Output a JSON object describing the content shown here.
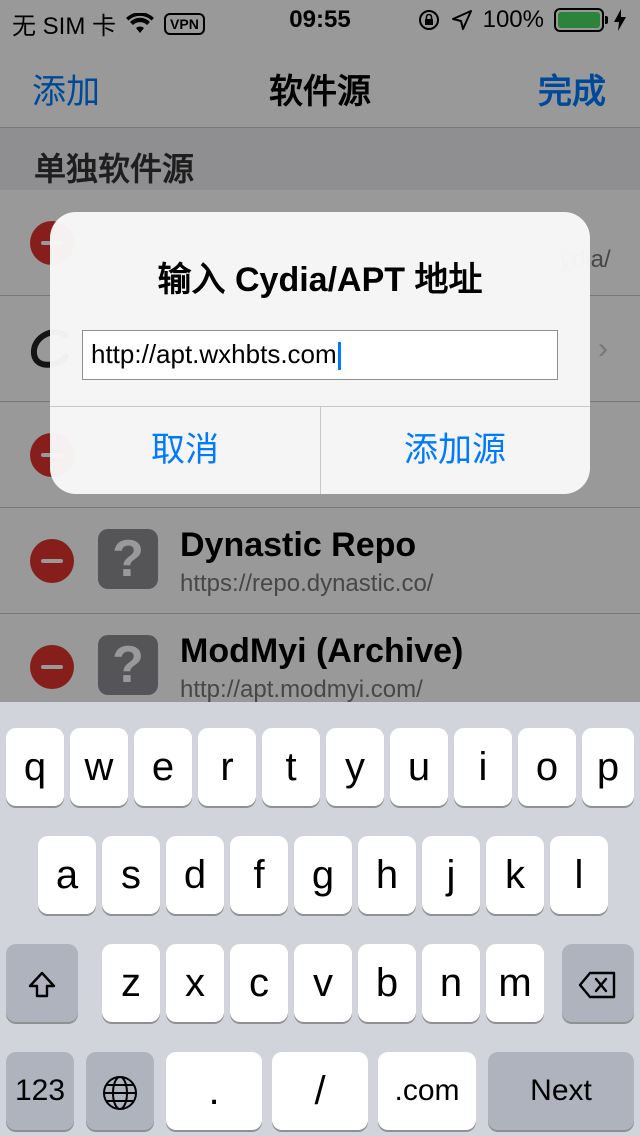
{
  "status": {
    "carrier": "无 SIM 卡",
    "vpn": "VPN",
    "time": "09:55",
    "battery": "100%",
    "battery_level": 1.0
  },
  "nav": {
    "left": "添加",
    "title": "软件源",
    "right": "完成"
  },
  "section": {
    "title": "单独软件源"
  },
  "sources": [
    {
      "name": "Dynastic Repo",
      "url": "https://repo.dynastic.co/"
    },
    {
      "name": "ModMyi (Archive)",
      "url": "http://apt.modmyi.com/"
    }
  ],
  "partial": {
    "url_fragment": "ydia/"
  },
  "alert": {
    "title": "输入 Cydia/APT 地址",
    "input_value": "http://apt.wxhbts.com",
    "cancel": "取消",
    "add": "添加源"
  },
  "keyboard": {
    "row1": [
      "q",
      "w",
      "e",
      "r",
      "t",
      "y",
      "u",
      "i",
      "o",
      "p"
    ],
    "row2": [
      "a",
      "s",
      "d",
      "f",
      "g",
      "h",
      "j",
      "k",
      "l"
    ],
    "row3": [
      "z",
      "x",
      "c",
      "v",
      "b",
      "n",
      "m"
    ],
    "numbers": "123",
    "dot": ".",
    "slash": "/",
    "dotcom": ".com",
    "next": "Next"
  }
}
